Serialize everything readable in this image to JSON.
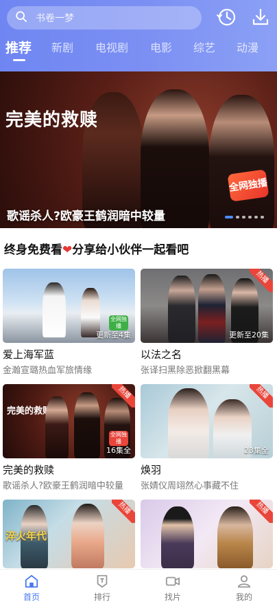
{
  "search": {
    "placeholder": "书卷一梦"
  },
  "tabs": [
    {
      "label": "推荐",
      "active": true
    },
    {
      "label": "新剧"
    },
    {
      "label": "电视剧"
    },
    {
      "label": "电影"
    },
    {
      "label": "综艺"
    },
    {
      "label": "动漫"
    }
  ],
  "hero": {
    "logo_text": "完美的救赎",
    "caption": "歌谣杀人?欧豪王鹤润暗中较量",
    "badge": "全网独播",
    "slides": 6,
    "active_slide": 1
  },
  "section": {
    "title_before": "终身免费看",
    "title_after": "分享给小伙伴一起看吧"
  },
  "cards": [
    {
      "title": "爱上海军蓝",
      "desc": "金瀚宣璐热血军旅情缘",
      "episodes": "更新至4集",
      "badge": "全网独播"
    },
    {
      "title": "以法之名",
      "desc": "张译扫黑除恶掀翻黑幕",
      "episodes": "更新至20集",
      "ribbon": "热播"
    },
    {
      "title": "完美的救赎",
      "desc": "歌谣杀人?欧豪王鹤润暗中较量",
      "episodes": "16集全",
      "ribbon": "热播",
      "badge": "全网独播"
    },
    {
      "title": "焕羽",
      "desc": "张婧仪周翊然心事藏不住",
      "episodes": "23集全",
      "ribbon": "热播"
    },
    {
      "title": "淬火年代",
      "desc": "",
      "episodes": "",
      "ribbon": "热播"
    },
    {
      "title": "",
      "desc": "",
      "episodes": "",
      "ribbon": "热播"
    }
  ],
  "bottom_nav": [
    {
      "label": "首页",
      "active": true
    },
    {
      "label": "排行"
    },
    {
      "label": "找片"
    },
    {
      "label": "我的"
    }
  ],
  "colors": {
    "accent": "#4a78f0",
    "hot": "#e9453a",
    "header": "#7b8ff3"
  }
}
